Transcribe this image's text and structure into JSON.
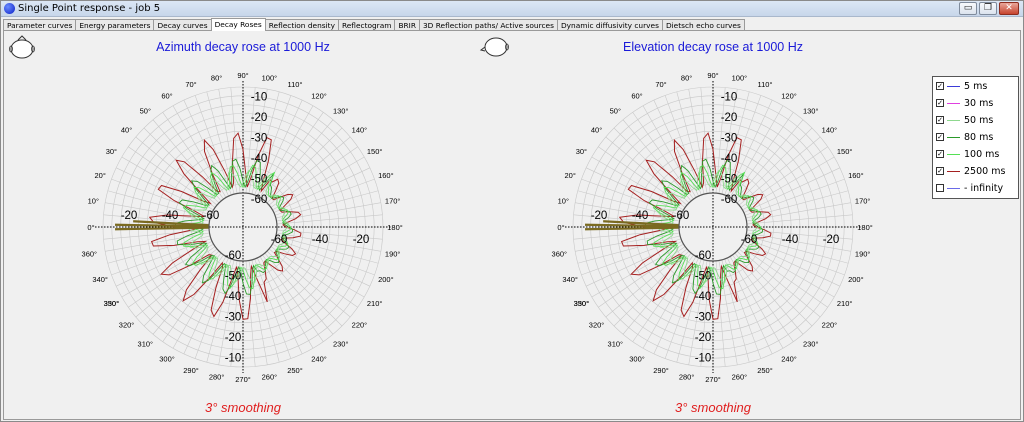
{
  "window": {
    "title": "Single Point response - job 5",
    "buttons": {
      "minimize": "▭",
      "restore": "❐",
      "close": "✕"
    }
  },
  "tabs": [
    {
      "label": "Parameter curves",
      "active": false
    },
    {
      "label": "Energy parameters",
      "active": false
    },
    {
      "label": "Decay curves",
      "active": false
    },
    {
      "label": "Decay Roses",
      "active": true
    },
    {
      "label": "Reflection density",
      "active": false
    },
    {
      "label": "Reflectogram",
      "active": false
    },
    {
      "label": "BRIR",
      "active": false
    },
    {
      "label": "3D Reflection paths/ Active sources",
      "active": false
    },
    {
      "label": "Dynamic diffusivity curves",
      "active": false
    },
    {
      "label": "Dietsch echo curves",
      "active": false
    }
  ],
  "roses": [
    {
      "title": "Azimuth decay rose at 1000 Hz",
      "footer": "3° smoothing",
      "head_icon": "head-top-view-icon"
    },
    {
      "title": "Elevation decay rose at 1000 Hz",
      "footer": "3° smoothing",
      "head_icon": "head-side-view-icon"
    }
  ],
  "polar_axis": {
    "radial_labels_inner_to_outer": [
      "-60",
      "-50",
      "-40",
      "-30",
      "-20",
      "-10"
    ],
    "angle_labels": [
      "0°",
      "10°",
      "20°",
      "30°",
      "40°",
      "50°",
      "60°",
      "70°",
      "80°",
      "90°",
      "100°",
      "110°",
      "120°",
      "130°",
      "140°",
      "150°",
      "160°",
      "170°",
      "180°",
      "190°",
      "200°",
      "210°",
      "220°",
      "230°",
      "240°",
      "250°",
      "260°",
      "270°",
      "280°",
      "290°",
      "300°",
      "310°",
      "320°",
      "330°",
      "340°",
      "350°",
      "360°"
    ]
  },
  "legend": [
    {
      "label": "5 ms",
      "color": "#3b3bd8",
      "checked": true
    },
    {
      "label": "30 ms",
      "color": "#e040e0",
      "checked": true
    },
    {
      "label": "50 ms",
      "color": "#8fd88f",
      "checked": true
    },
    {
      "label": "80 ms",
      "color": "#2a9a2a",
      "checked": true
    },
    {
      "label": "100 ms",
      "color": "#55e055",
      "checked": true
    },
    {
      "label": "2500 ms",
      "color": "#a52020",
      "checked": true
    },
    {
      "label": " - infinity",
      "color": "#6a6ae8",
      "checked": false
    }
  ],
  "colors": {
    "title_blue": "#1a1ad8",
    "footer_red": "#e02020",
    "grid": "#c8c8c8"
  }
}
